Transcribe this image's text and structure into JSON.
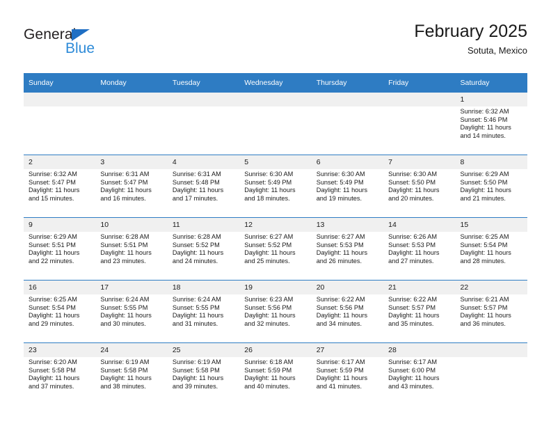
{
  "brand": {
    "name_top": "General",
    "name_bottom": "Blue",
    "triangle_icon": "triangle-icon",
    "color_dark": "#231f20",
    "color_blue": "#2e8bd8"
  },
  "header": {
    "month_title": "February 2025",
    "location": "Sotuta, Mexico"
  },
  "theme": {
    "header_blue": "#2e7cc3",
    "daynum_band": "#f0f0f0",
    "text": "#1a1a1a"
  },
  "weekday_headers": [
    "Sunday",
    "Monday",
    "Tuesday",
    "Wednesday",
    "Thursday",
    "Friday",
    "Saturday"
  ],
  "weeks": [
    {
      "days": [
        {
          "num": "",
          "empty": true,
          "sunrise": "",
          "sunset": "",
          "daylight_line1": "",
          "daylight_line2": ""
        },
        {
          "num": "",
          "empty": true,
          "sunrise": "",
          "sunset": "",
          "daylight_line1": "",
          "daylight_line2": ""
        },
        {
          "num": "",
          "empty": true,
          "sunrise": "",
          "sunset": "",
          "daylight_line1": "",
          "daylight_line2": ""
        },
        {
          "num": "",
          "empty": true,
          "sunrise": "",
          "sunset": "",
          "daylight_line1": "",
          "daylight_line2": ""
        },
        {
          "num": "",
          "empty": true,
          "sunrise": "",
          "sunset": "",
          "daylight_line1": "",
          "daylight_line2": ""
        },
        {
          "num": "",
          "empty": true,
          "sunrise": "",
          "sunset": "",
          "daylight_line1": "",
          "daylight_line2": ""
        },
        {
          "num": "1",
          "empty": false,
          "sunrise": "Sunrise: 6:32 AM",
          "sunset": "Sunset: 5:46 PM",
          "daylight_line1": "Daylight: 11 hours",
          "daylight_line2": "and 14 minutes."
        }
      ]
    },
    {
      "days": [
        {
          "num": "2",
          "empty": false,
          "sunrise": "Sunrise: 6:32 AM",
          "sunset": "Sunset: 5:47 PM",
          "daylight_line1": "Daylight: 11 hours",
          "daylight_line2": "and 15 minutes."
        },
        {
          "num": "3",
          "empty": false,
          "sunrise": "Sunrise: 6:31 AM",
          "sunset": "Sunset: 5:47 PM",
          "daylight_line1": "Daylight: 11 hours",
          "daylight_line2": "and 16 minutes."
        },
        {
          "num": "4",
          "empty": false,
          "sunrise": "Sunrise: 6:31 AM",
          "sunset": "Sunset: 5:48 PM",
          "daylight_line1": "Daylight: 11 hours",
          "daylight_line2": "and 17 minutes."
        },
        {
          "num": "5",
          "empty": false,
          "sunrise": "Sunrise: 6:30 AM",
          "sunset": "Sunset: 5:49 PM",
          "daylight_line1": "Daylight: 11 hours",
          "daylight_line2": "and 18 minutes."
        },
        {
          "num": "6",
          "empty": false,
          "sunrise": "Sunrise: 6:30 AM",
          "sunset": "Sunset: 5:49 PM",
          "daylight_line1": "Daylight: 11 hours",
          "daylight_line2": "and 19 minutes."
        },
        {
          "num": "7",
          "empty": false,
          "sunrise": "Sunrise: 6:30 AM",
          "sunset": "Sunset: 5:50 PM",
          "daylight_line1": "Daylight: 11 hours",
          "daylight_line2": "and 20 minutes."
        },
        {
          "num": "8",
          "empty": false,
          "sunrise": "Sunrise: 6:29 AM",
          "sunset": "Sunset: 5:50 PM",
          "daylight_line1": "Daylight: 11 hours",
          "daylight_line2": "and 21 minutes."
        }
      ]
    },
    {
      "days": [
        {
          "num": "9",
          "empty": false,
          "sunrise": "Sunrise: 6:29 AM",
          "sunset": "Sunset: 5:51 PM",
          "daylight_line1": "Daylight: 11 hours",
          "daylight_line2": "and 22 minutes."
        },
        {
          "num": "10",
          "empty": false,
          "sunrise": "Sunrise: 6:28 AM",
          "sunset": "Sunset: 5:51 PM",
          "daylight_line1": "Daylight: 11 hours",
          "daylight_line2": "and 23 minutes."
        },
        {
          "num": "11",
          "empty": false,
          "sunrise": "Sunrise: 6:28 AM",
          "sunset": "Sunset: 5:52 PM",
          "daylight_line1": "Daylight: 11 hours",
          "daylight_line2": "and 24 minutes."
        },
        {
          "num": "12",
          "empty": false,
          "sunrise": "Sunrise: 6:27 AM",
          "sunset": "Sunset: 5:52 PM",
          "daylight_line1": "Daylight: 11 hours",
          "daylight_line2": "and 25 minutes."
        },
        {
          "num": "13",
          "empty": false,
          "sunrise": "Sunrise: 6:27 AM",
          "sunset": "Sunset: 5:53 PM",
          "daylight_line1": "Daylight: 11 hours",
          "daylight_line2": "and 26 minutes."
        },
        {
          "num": "14",
          "empty": false,
          "sunrise": "Sunrise: 6:26 AM",
          "sunset": "Sunset: 5:53 PM",
          "daylight_line1": "Daylight: 11 hours",
          "daylight_line2": "and 27 minutes."
        },
        {
          "num": "15",
          "empty": false,
          "sunrise": "Sunrise: 6:25 AM",
          "sunset": "Sunset: 5:54 PM",
          "daylight_line1": "Daylight: 11 hours",
          "daylight_line2": "and 28 minutes."
        }
      ]
    },
    {
      "days": [
        {
          "num": "16",
          "empty": false,
          "sunrise": "Sunrise: 6:25 AM",
          "sunset": "Sunset: 5:54 PM",
          "daylight_line1": "Daylight: 11 hours",
          "daylight_line2": "and 29 minutes."
        },
        {
          "num": "17",
          "empty": false,
          "sunrise": "Sunrise: 6:24 AM",
          "sunset": "Sunset: 5:55 PM",
          "daylight_line1": "Daylight: 11 hours",
          "daylight_line2": "and 30 minutes."
        },
        {
          "num": "18",
          "empty": false,
          "sunrise": "Sunrise: 6:24 AM",
          "sunset": "Sunset: 5:55 PM",
          "daylight_line1": "Daylight: 11 hours",
          "daylight_line2": "and 31 minutes."
        },
        {
          "num": "19",
          "empty": false,
          "sunrise": "Sunrise: 6:23 AM",
          "sunset": "Sunset: 5:56 PM",
          "daylight_line1": "Daylight: 11 hours",
          "daylight_line2": "and 32 minutes."
        },
        {
          "num": "20",
          "empty": false,
          "sunrise": "Sunrise: 6:22 AM",
          "sunset": "Sunset: 5:56 PM",
          "daylight_line1": "Daylight: 11 hours",
          "daylight_line2": "and 34 minutes."
        },
        {
          "num": "21",
          "empty": false,
          "sunrise": "Sunrise: 6:22 AM",
          "sunset": "Sunset: 5:57 PM",
          "daylight_line1": "Daylight: 11 hours",
          "daylight_line2": "and 35 minutes."
        },
        {
          "num": "22",
          "empty": false,
          "sunrise": "Sunrise: 6:21 AM",
          "sunset": "Sunset: 5:57 PM",
          "daylight_line1": "Daylight: 11 hours",
          "daylight_line2": "and 36 minutes."
        }
      ]
    },
    {
      "days": [
        {
          "num": "23",
          "empty": false,
          "sunrise": "Sunrise: 6:20 AM",
          "sunset": "Sunset: 5:58 PM",
          "daylight_line1": "Daylight: 11 hours",
          "daylight_line2": "and 37 minutes."
        },
        {
          "num": "24",
          "empty": false,
          "sunrise": "Sunrise: 6:19 AM",
          "sunset": "Sunset: 5:58 PM",
          "daylight_line1": "Daylight: 11 hours",
          "daylight_line2": "and 38 minutes."
        },
        {
          "num": "25",
          "empty": false,
          "sunrise": "Sunrise: 6:19 AM",
          "sunset": "Sunset: 5:58 PM",
          "daylight_line1": "Daylight: 11 hours",
          "daylight_line2": "and 39 minutes."
        },
        {
          "num": "26",
          "empty": false,
          "sunrise": "Sunrise: 6:18 AM",
          "sunset": "Sunset: 5:59 PM",
          "daylight_line1": "Daylight: 11 hours",
          "daylight_line2": "and 40 minutes."
        },
        {
          "num": "27",
          "empty": false,
          "sunrise": "Sunrise: 6:17 AM",
          "sunset": "Sunset: 5:59 PM",
          "daylight_line1": "Daylight: 11 hours",
          "daylight_line2": "and 41 minutes."
        },
        {
          "num": "28",
          "empty": false,
          "sunrise": "Sunrise: 6:17 AM",
          "sunset": "Sunset: 6:00 PM",
          "daylight_line1": "Daylight: 11 hours",
          "daylight_line2": "and 43 minutes."
        },
        {
          "num": "",
          "empty": true,
          "sunrise": "",
          "sunset": "",
          "daylight_line1": "",
          "daylight_line2": ""
        }
      ]
    }
  ]
}
